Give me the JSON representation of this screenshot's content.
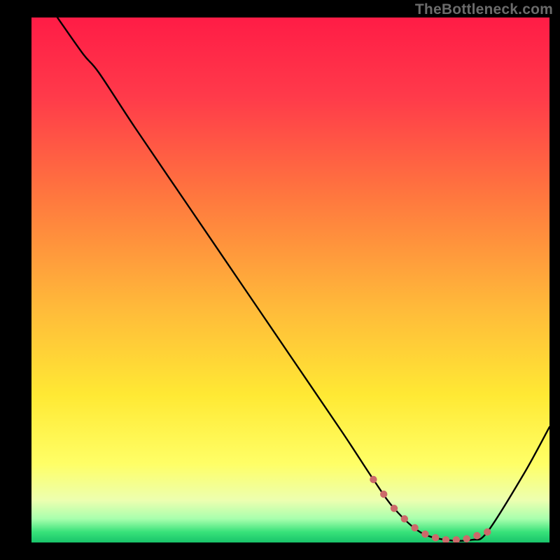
{
  "watermark": "TheBottleneck.com",
  "chart_data": {
    "type": "line",
    "title": "",
    "xlabel": "",
    "ylabel": "",
    "xlim": [
      0,
      100
    ],
    "ylim": [
      0,
      100
    ],
    "series": [
      {
        "name": "bottleneck-curve",
        "x": [
          5,
          10,
          13,
          20,
          30,
          40,
          50,
          60,
          66,
          70,
          75,
          80,
          85,
          88,
          95,
          100
        ],
        "y": [
          100,
          93,
          89.5,
          79,
          64.5,
          50,
          35.5,
          21,
          12,
          6.5,
          2,
          0.5,
          0.5,
          2,
          13,
          22
        ]
      }
    ],
    "marker_band": {
      "name": "optimal-range-markers",
      "color": "#cc6a6a",
      "x": [
        66,
        68,
        70,
        72,
        74,
        76,
        78,
        80,
        82,
        84,
        86,
        88
      ],
      "y": [
        12,
        9.2,
        6.5,
        4.5,
        2.8,
        1.6,
        0.9,
        0.5,
        0.5,
        0.7,
        1.3,
        2
      ]
    },
    "gradient_stops": [
      {
        "offset": 0.0,
        "color": "#ff1c46"
      },
      {
        "offset": 0.15,
        "color": "#ff3a4a"
      },
      {
        "offset": 0.35,
        "color": "#ff7a3e"
      },
      {
        "offset": 0.55,
        "color": "#ffb93a"
      },
      {
        "offset": 0.72,
        "color": "#ffe934"
      },
      {
        "offset": 0.85,
        "color": "#ffff66"
      },
      {
        "offset": 0.92,
        "color": "#ecffb0"
      },
      {
        "offset": 0.955,
        "color": "#a8ffad"
      },
      {
        "offset": 0.98,
        "color": "#38e27a"
      },
      {
        "offset": 1.0,
        "color": "#19c46a"
      }
    ]
  }
}
